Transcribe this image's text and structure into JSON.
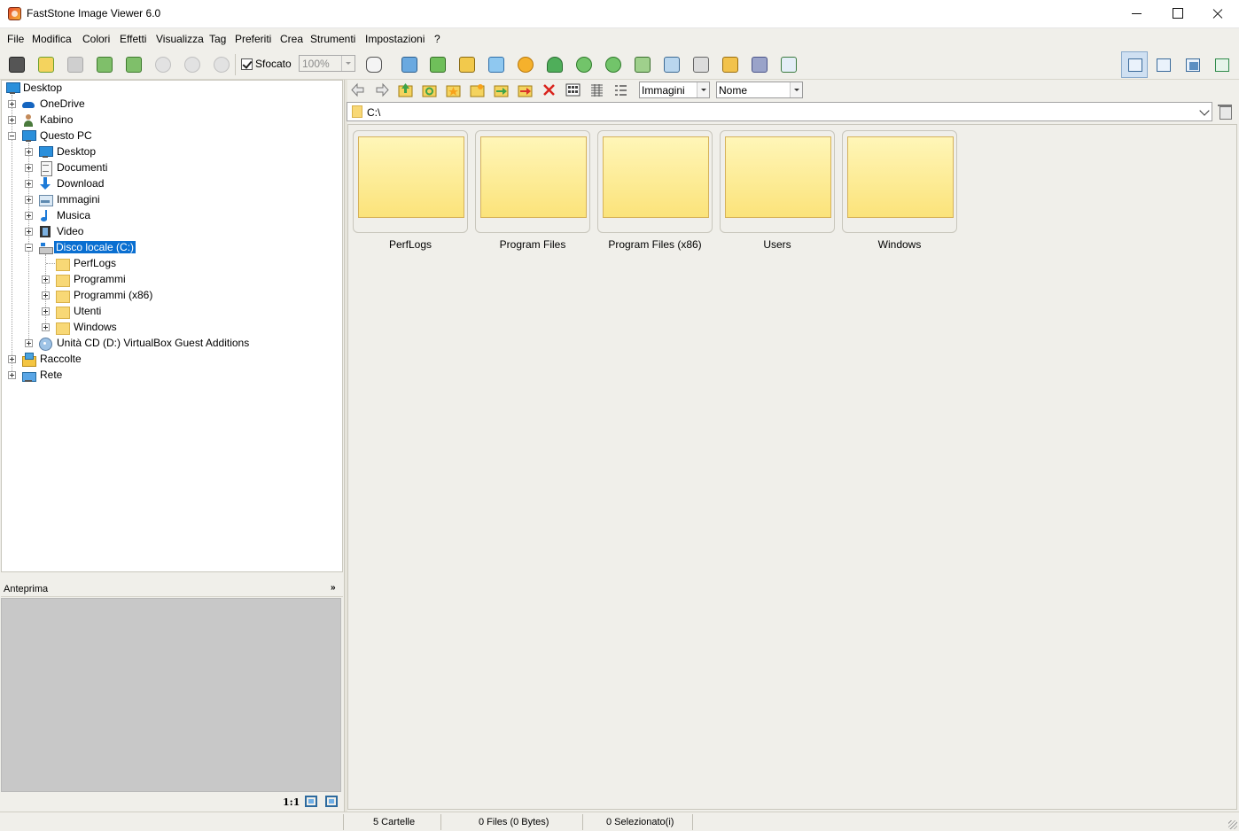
{
  "window": {
    "title": "FastStone Image Viewer 6.0"
  },
  "menu": [
    "File",
    "Modifica",
    "Colori",
    "Effetti",
    "Visualizza",
    "Tag",
    "Preferiti",
    "Crea",
    "Strumenti",
    "Impostazioni",
    "?"
  ],
  "toolbar": {
    "blur_label": "Sfocato",
    "blur_checked": true,
    "zoom_value": "100%"
  },
  "tree": {
    "root": "Desktop",
    "onedrive": "OneDrive",
    "user": "Kabino",
    "this_pc": "Questo PC",
    "desktop": "Desktop",
    "documents": "Documenti",
    "download": "Download",
    "images": "Immagini",
    "music": "Musica",
    "video": "Video",
    "local_disk": "Disco locale (C:)",
    "perflogs": "PerfLogs",
    "programs": "Programmi",
    "programs_x86": "Programmi (x86)",
    "users": "Utenti",
    "windows": "Windows",
    "cd_drive": "Unità CD (D:) VirtualBox Guest Additions",
    "collections": "Raccolte",
    "network": "Rete"
  },
  "preview": {
    "title": "Anteprima",
    "one_to_one": "1:1"
  },
  "browser": {
    "filter_value": "Immagini",
    "sort_value": "Nome",
    "path": "C:\\",
    "items": [
      "PerfLogs",
      "Program Files",
      "Program Files (x86)",
      "Users",
      "Windows"
    ]
  },
  "status": {
    "folders": "5 Cartelle",
    "files": "0 Files (0 Bytes)",
    "selected": "0 Selezionato(i)"
  },
  "colors": {
    "selection": "#0a6fd1",
    "folder_fill": "#fbe37a",
    "background": "#f0efea"
  },
  "icons": {
    "toolbar": [
      "camera-icon",
      "open-folder-icon",
      "save-icon",
      "prev-icon",
      "next-icon",
      "zoom-in-icon",
      "zoom-out-icon",
      "fit-icon",
      "hand-icon",
      "slideshow-icon",
      "upload-icon",
      "crop-icon",
      "cb-icon",
      "brightness-icon",
      "stamp-icon",
      "rotate-left-icon",
      "rotate-right-icon",
      "compare-icon",
      "wallpaper-icon",
      "scan-icon",
      "email-icon",
      "print-icon",
      "batch-icon"
    ],
    "nav": [
      "back-icon",
      "forward-icon",
      "up-folder-icon",
      "refresh-folder-icon",
      "favorites-icon",
      "new-folder-icon",
      "copy-to-icon",
      "move-to-icon",
      "delete-icon",
      "thumbnails-view-icon",
      "list-view-icon",
      "details-view-icon"
    ]
  }
}
